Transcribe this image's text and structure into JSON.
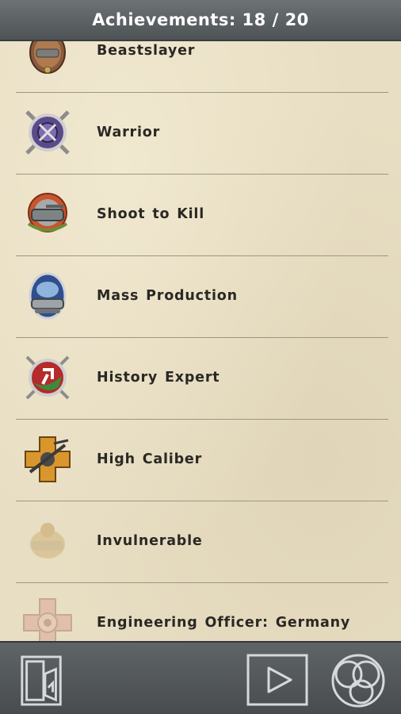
{
  "header": {
    "title": "Achievements: 18 / 20"
  },
  "achievements": [
    {
      "name": "Beastslayer",
      "icon": "beastslayer-badge-icon",
      "unlocked": true
    },
    {
      "name": "Warrior",
      "icon": "warrior-badge-icon",
      "unlocked": true
    },
    {
      "name": "Shoot to Kill",
      "icon": "shoot-to-kill-badge-icon",
      "unlocked": true
    },
    {
      "name": "Mass Production",
      "icon": "mass-production-badge-icon",
      "unlocked": true
    },
    {
      "name": "History Expert",
      "icon": "history-expert-badge-icon",
      "unlocked": true
    },
    {
      "name": "High Caliber",
      "icon": "high-caliber-badge-icon",
      "unlocked": true
    },
    {
      "name": "Invulnerable",
      "icon": "invulnerable-badge-icon",
      "unlocked": false
    },
    {
      "name": "Engineering Officer: Germany",
      "icon": "engineering-officer-badge-icon",
      "unlocked": false
    }
  ],
  "footer": {
    "icons": [
      "exit-door-icon",
      "play-icon",
      "circles-menu-icon"
    ]
  },
  "colors": {
    "background": "#e8dec3",
    "header": "#5a5f62",
    "text": "#2a2824"
  }
}
